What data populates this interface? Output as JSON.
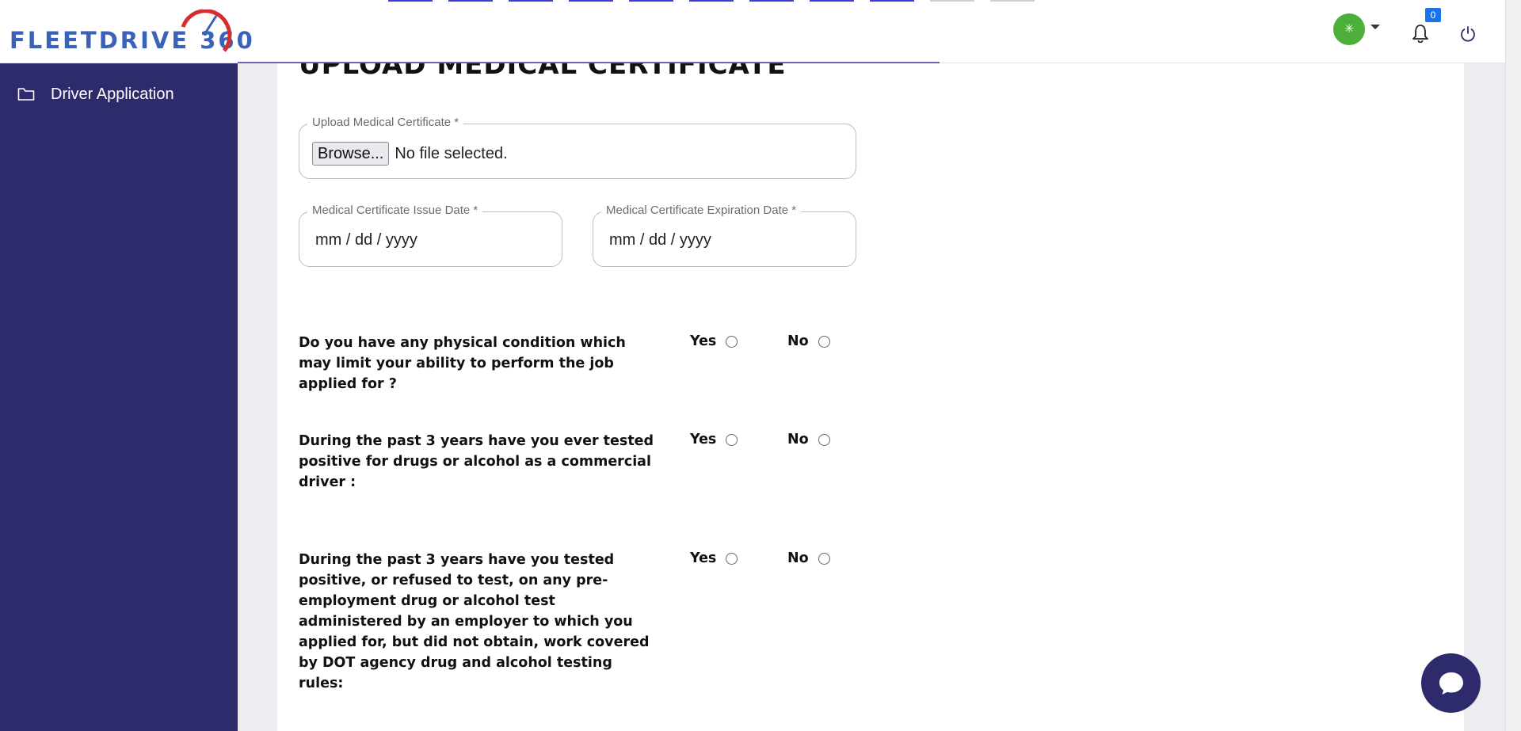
{
  "header": {
    "logo_text": "FLEETDRIVE 360",
    "avatar_glyph": "✳",
    "notification_count": "0",
    "colors": {
      "brand_blue": "#3a62b8",
      "gauge_red": "#d62c2c",
      "avatar_green": "#4caf3a",
      "badge_blue": "#1a73e8"
    }
  },
  "sidebar": {
    "items": [
      {
        "label": "Driver Application",
        "icon": "folder-icon"
      }
    ],
    "background": "#2d2b6b"
  },
  "form": {
    "section_title": "UPLOAD MEDICAL CERTIFICATE",
    "upload": {
      "label": "Upload Medical Certificate *",
      "button_label": "Browse...",
      "status_text": "No file selected."
    },
    "issue_date": {
      "label": "Medical Certificate Issue Date *",
      "value": "mm / dd / yyyy"
    },
    "expiration_date": {
      "label": "Medical Certificate Expiration Date *",
      "value": "mm / dd / yyyy"
    },
    "questions": [
      {
        "text": "Do you have any physical condition which may limit your ability to perform the job applied for ?",
        "yes_label": "Yes",
        "no_label": "No"
      },
      {
        "text": "During the past 3 years have you ever tested positive for drugs or alcohol as a commercial driver :",
        "yes_label": "Yes",
        "no_label": "No"
      },
      {
        "text": "During the past 3 years have you tested positive, or refused to test, on any pre-employment drug or alcohol test administered by an employer to which you applied for, but did not obtain, work covered by DOT agency drug and alcohol testing rules:",
        "yes_label": "Yes",
        "no_label": "No"
      }
    ]
  },
  "chat": {
    "icon": "chat-bubble-icon"
  }
}
